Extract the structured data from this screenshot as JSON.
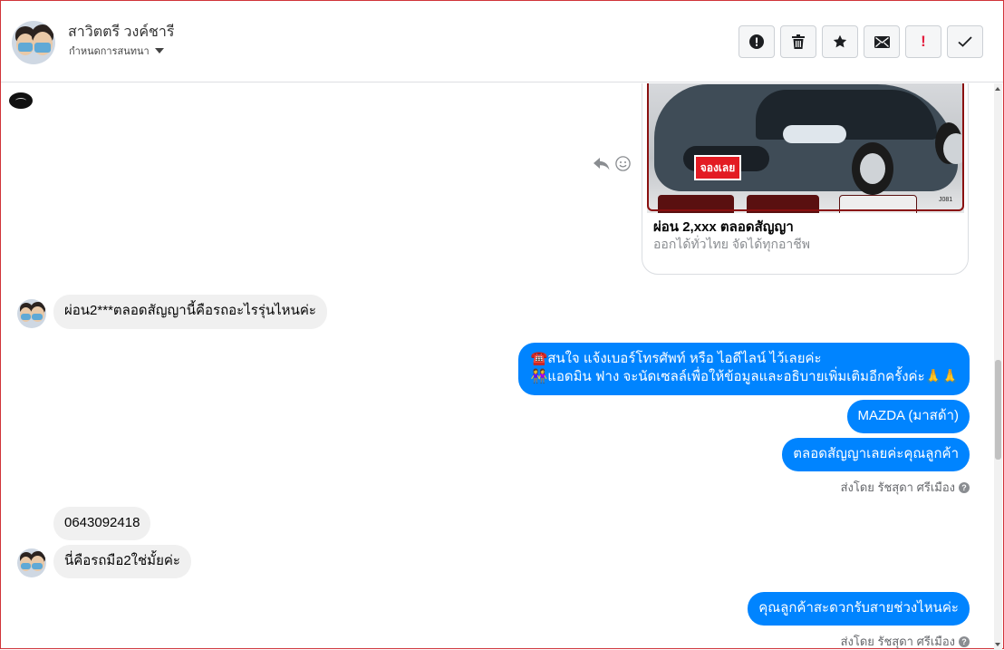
{
  "header": {
    "contact_name": "สาวิตตรี วงค์ชารี",
    "assign_label": "กำหนดการสนทนา",
    "actions": [
      {
        "name": "report-button",
        "icon": "alert-circle-icon"
      },
      {
        "name": "delete-button",
        "icon": "trash-icon"
      },
      {
        "name": "star-button",
        "icon": "star-icon"
      },
      {
        "name": "mark-unread-button",
        "icon": "envelope-icon"
      },
      {
        "name": "important-button",
        "icon": "exclamation-icon",
        "label": "!"
      },
      {
        "name": "done-button",
        "icon": "check-icon"
      }
    ]
  },
  "card": {
    "image_badge": "จองเลย",
    "image_tag": "J081",
    "title": "ผ่อน 2,xxx ตลอดสัญญา",
    "subtitle": "ออกได้ทั่วไทย จัดได้ทุกอาชีพ"
  },
  "messages": {
    "in1": "ผ่อน2***ตลอดสัญญานี้คือรถอะไรรุ่นไหนค่ะ",
    "out1_line1": "☎️สนใจ แจ้งเบอร์โทรศัพท์ หรือ ไอดีไลน์  ไว้เลยค่ะ",
    "out1_line2": "👭แอดมิน ฟาง จะนัดเซลล์เพื่อให้ข้อมูลและอธิบายเพิ่มเติมอีกครั้งค่ะ🙏🙏",
    "out2": "MAZDA (มาสด้า)",
    "out3": "ตลอดสัญญาเลยค่ะคุณลูกค้า",
    "sent_by_1": "ส่งโดย รัชสุดา ศรีเมือง",
    "in2": "0643092418",
    "in3": "นี่คือรถมือ2ใช่มั้ยค่ะ",
    "out4": "คุณลูกค้าสะดวกรับสายช่วงไหนค่ะ",
    "sent_by_2": "ส่งโดย รัชสุดา ศรีเมือง"
  },
  "colors": {
    "outgoing_bubble": "#0084ff",
    "incoming_bubble": "#f0f0f0",
    "important_red": "#e41e3f"
  }
}
